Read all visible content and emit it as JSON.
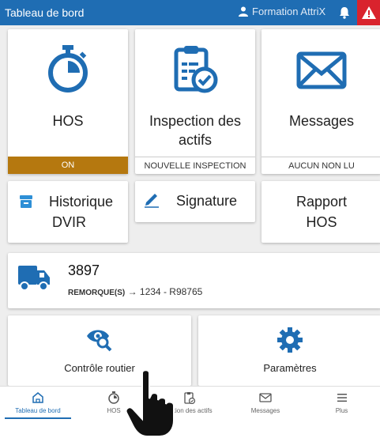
{
  "topbar": {
    "title": "Tableau de bord",
    "user": "Formation AttriX"
  },
  "tiles": {
    "hos": {
      "label": "HOS",
      "status": "ON"
    },
    "inspection": {
      "label_line1": "Inspection des",
      "label_line2": "actifs",
      "status": "NOUVELLE INSPECTION"
    },
    "messages": {
      "label": "Messages",
      "status": "AUCUN NON LU"
    },
    "dvir": {
      "label_line1": "Historique",
      "label_line2": "DVIR"
    },
    "signature": {
      "label": "Signature"
    },
    "rapport": {
      "label_line1": "Rapport",
      "label_line2": "HOS"
    },
    "controle": {
      "label": "Contrôle routier"
    },
    "parametres": {
      "label": "Paramètres"
    }
  },
  "vehicle": {
    "number": "3897",
    "trailer_prefix": "REMORQUE(S)",
    "trailer_value": "→ 1234 - R98765"
  },
  "nav": {
    "items": [
      {
        "label": "Tableau de bord"
      },
      {
        "label": "HOS"
      },
      {
        "label": "Inspection des actifs",
        "visible_label": "ection des actifs"
      },
      {
        "label": "Messages"
      },
      {
        "label": "Plus"
      }
    ]
  },
  "colors": {
    "primary": "#1f6db3",
    "hos_on": "#b5780f",
    "alert": "#d9232d"
  }
}
